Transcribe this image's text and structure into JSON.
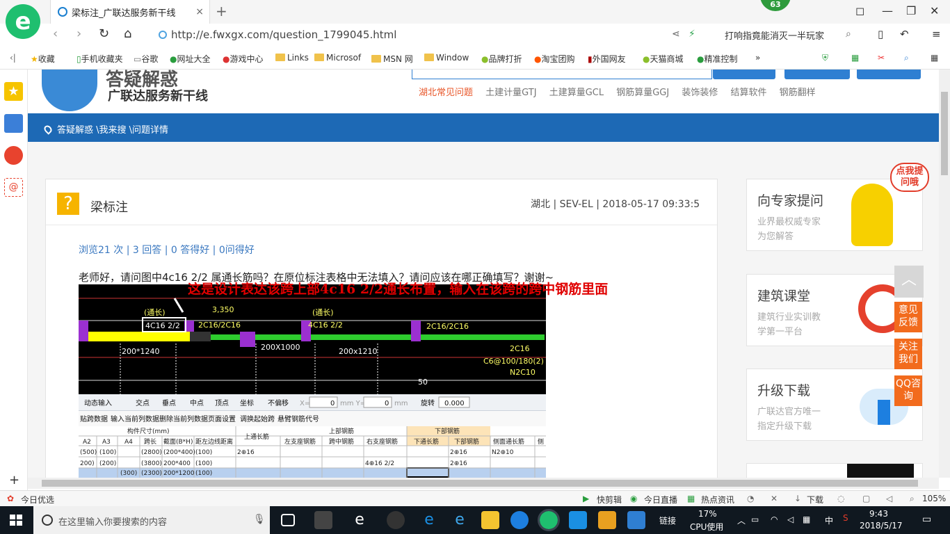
{
  "browser": {
    "badge_count": "63",
    "tab_title": "梁标注_广联达服务新干线",
    "tab_close": "×",
    "new_tab": "+",
    "url": "http://e.fwxgx.com/question_1799045.html",
    "search_text": "打响指竟能消灭一半玩家",
    "bookmarks": [
      "收藏",
      "手机收藏夹",
      "谷歌",
      "网址大全",
      "游戏中心",
      "Links",
      "Microsof",
      "MSN 网",
      "Window",
      "品牌打折",
      "淘宝团购",
      "外国网友",
      "天猫商城",
      "精准控制"
    ],
    "more": "»"
  },
  "page": {
    "brand_top": "答疑解惑",
    "brand": "广联达服务新干线",
    "categories": [
      "湖北常见问题",
      "土建计量GTJ",
      "土建算量GCL",
      "钢筋算量GGJ",
      "装饰装修",
      "结算软件",
      "钢筋翻样"
    ],
    "breadcrumb": "答疑解惑 \\我来搜 \\问题详情",
    "question": {
      "mark": "?",
      "title": "梁标注",
      "meta": "湖北 | SEV-EL | 2018-05-17 09:33:5",
      "stats": "浏览21 次 | 3 回答 | 0 答得好 | 0问得好",
      "body": "老师好，请问图中4c16 2/2 属通长筋吗？在原位标注表格中无法填入？请问应该在哪正确填写？谢谢~"
    },
    "annotation": "这是设计表达该跨上部4c16 2/2通长布置，输入在该跨的跨中钢筋里面",
    "cad": {
      "labels": [
        "(通长)",
        "4C16 2/2",
        "3,350",
        "2C16/2C16",
        "(通长)",
        "4C16 2/2",
        "2C16/2C16",
        "200X1000",
        "200*1240",
        "200x1210",
        "2C16",
        "C6@100/180(2)",
        "N2C10",
        "50"
      ]
    },
    "toolbar": {
      "items": [
        "动态输入",
        "交点",
        "垂点",
        "中点",
        "顶点",
        "坐标",
        "不偏移",
        "X=",
        "0",
        "mm Y=",
        "0",
        "mm",
        "旋转",
        "0.000"
      ]
    },
    "menu": [
      "贴跨数据",
      "输入当前列数据",
      "删除当前列数据",
      "页面设置",
      "调换起始跨",
      "悬臂钢筋代号"
    ],
    "grid": {
      "group_headers": [
        "构件尺寸(mm)",
        "上通长筋",
        "上部钢筋",
        "下部钢筋"
      ],
      "columns": [
        "A2",
        "A3",
        "A4",
        "跨长",
        "截面(B*H)",
        "距左边线距离",
        "左支座钢筋",
        "跨中钢筋",
        "右支座钢筋",
        "下通长筋",
        "下部钢筋",
        "侧面通长筋",
        "侧"
      ],
      "rows": [
        [
          "(500)",
          "(100)",
          "",
          "(2800)",
          "(200*400)",
          "(100)",
          "2⊕16",
          "",
          "",
          "",
          "",
          "2⊕16",
          "N2⊕10"
        ],
        [
          "200)",
          "(200)",
          "",
          "(3800)",
          "200*400",
          "(100)",
          "",
          "",
          "",
          "4⊕16 2/2",
          "",
          "2⊕16",
          ""
        ],
        [
          "",
          "(300)",
          "(2300)",
          "200*1200",
          "(100)",
          "",
          "",
          "",
          "",
          "",
          "",
          "",
          ""
        ]
      ]
    },
    "side_cards": [
      {
        "title": "向专家提问",
        "line1": "业界最权威专家",
        "line2": "为您解答",
        "bubble": "点我提问哦"
      },
      {
        "title": "建筑课堂",
        "line1": "建筑行业实训教",
        "line2": "学第一平台"
      },
      {
        "title": "升级下载",
        "line1": "广联达官方唯一",
        "line2": "指定升级下载"
      }
    ],
    "float_buttons": [
      "意见反馈",
      "关注我们",
      "QQ咨询"
    ]
  },
  "statusbar": {
    "left": "今日优选",
    "items": [
      "快剪辑",
      "今日直播",
      "热点资讯",
      "下载",
      "105%"
    ]
  },
  "taskbar": {
    "search_placeholder": "在这里输入你要搜索的内容",
    "tray_link": "链接",
    "cpu": "17%",
    "cpu_label": "CPU使用",
    "ime": "中",
    "time": "9:43",
    "date": "2018/5/17"
  },
  "colors": {
    "bluebar": "#1d69b5",
    "accent_orange": "#f26b1d",
    "annotation_red": "#e00000"
  }
}
